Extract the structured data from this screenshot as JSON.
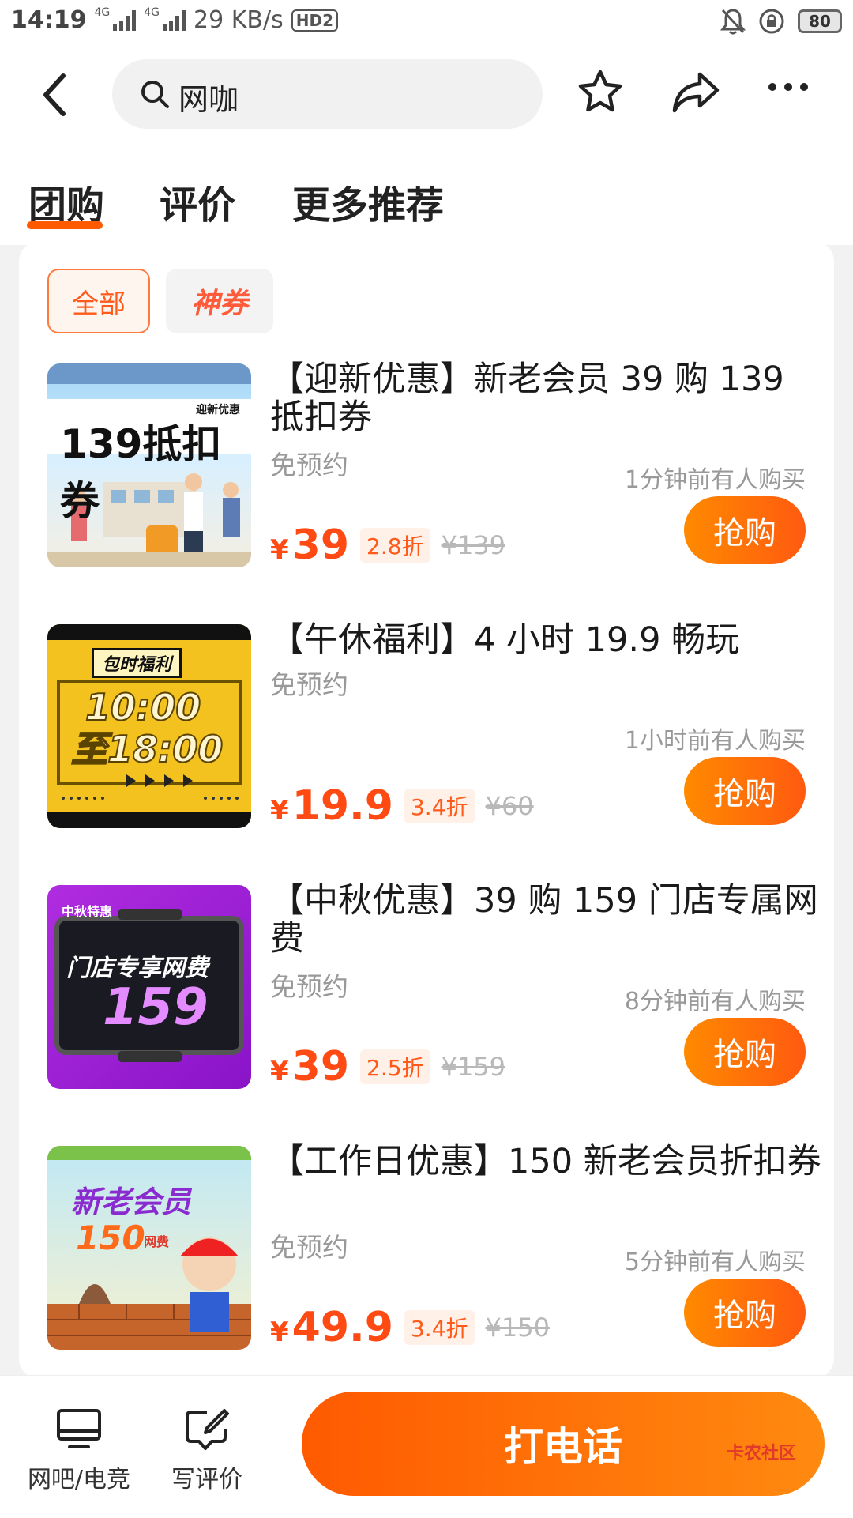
{
  "status_bar": {
    "time": "14:19",
    "net_small_1": "4G",
    "net_small_2": "4G",
    "speed": "29 KB/s",
    "hd": "HD2",
    "battery": "80"
  },
  "header": {
    "search_text": "网咖"
  },
  "tabs": [
    {
      "label": "团购"
    },
    {
      "label": "评价"
    },
    {
      "label": "更多推荐"
    }
  ],
  "filters": {
    "all": "全部",
    "shen": "神券"
  },
  "deals": [
    {
      "title": "【迎新优惠】新老会员 39 购 139 抵扣券",
      "badge": "免预约",
      "recent": "1分钟前有人购买",
      "yen": "¥",
      "price": "39",
      "discount": "2.8折",
      "original": "¥139",
      "buy": "抢购",
      "thumb": {
        "big": "139抵扣券",
        "small": "迎新优惠"
      }
    },
    {
      "title": "【午休福利】4 小时 19.9 畅玩",
      "badge": "免预约",
      "recent": "1小时前有人购买",
      "yen": "¥",
      "price": "19.9",
      "discount": "3.4折",
      "original": "¥60",
      "buy": "抢购",
      "thumb": {
        "tag": "包时福利",
        "line1": "10:00",
        "line2": "至18:00"
      }
    },
    {
      "title": "【中秋优惠】39 购 159 门店专属网费",
      "badge": "免预约",
      "recent": "8分钟前有人购买",
      "yen": "¥",
      "price": "39",
      "discount": "2.5折",
      "original": "¥159",
      "buy": "抢购",
      "thumb": {
        "tag": "中秋特惠",
        "line1": "门店专享网费",
        "line2": "159"
      }
    },
    {
      "title": "【工作日优惠】150 新老会员折扣券",
      "badge": "免预约",
      "recent": "5分钟前有人购买",
      "yen": "¥",
      "price": "49.9",
      "discount": "3.4折",
      "original": "¥150",
      "buy": "抢购",
      "thumb": {
        "line1": "新老会员",
        "line2": "150",
        "tag": "网费"
      }
    }
  ],
  "bottom": {
    "item1": "网吧/电竞",
    "item2": "写评价",
    "call": "打电话",
    "watermark": "卡农社区"
  },
  "colors": {
    "accent": "#ff5a00",
    "price": "#ff4a14"
  }
}
